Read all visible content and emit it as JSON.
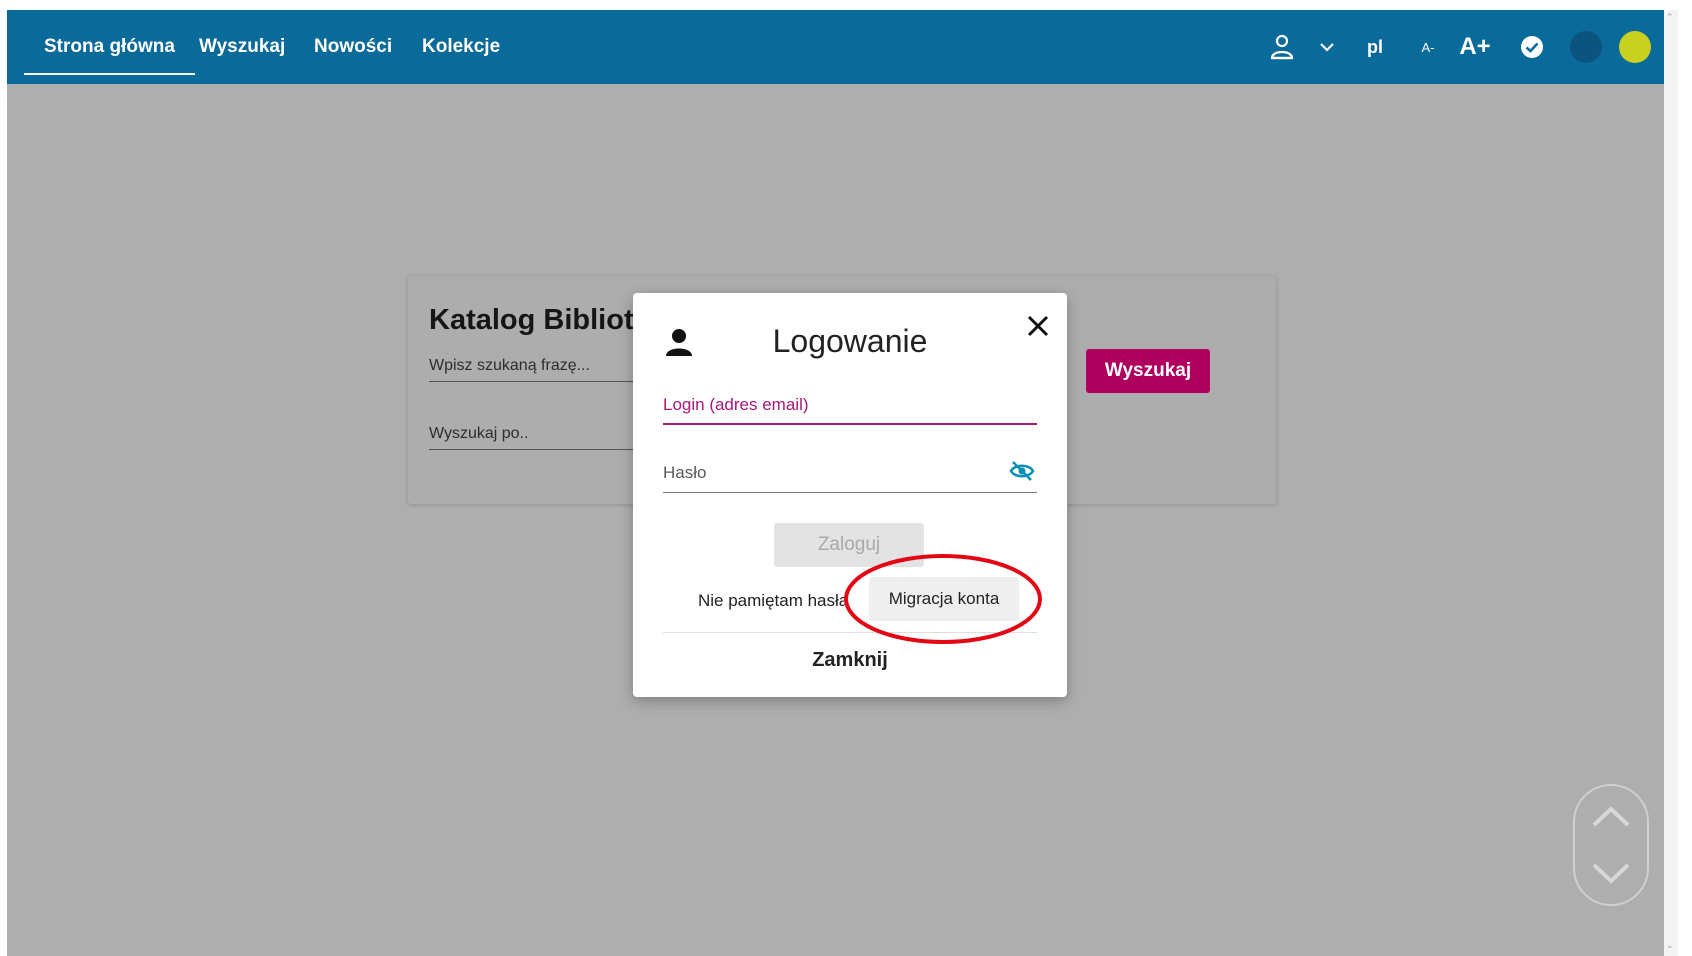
{
  "nav": {
    "items": [
      {
        "label": "Strona główna",
        "active": true
      },
      {
        "label": "Wyszukaj",
        "active": false
      },
      {
        "label": "Nowości",
        "active": false
      },
      {
        "label": "Kolekcje",
        "active": false
      }
    ],
    "language": "pl",
    "font_smaller": "A-",
    "font_larger": "A+",
    "icons": [
      "user-icon",
      "chevron-down-icon",
      "check-circle-icon",
      "theme-dark-icon",
      "theme-contrast-icon"
    ]
  },
  "colors": {
    "topbar": "#0a6a99",
    "accent": "#b0005e",
    "theme_dark": "#0c5480",
    "theme_yellow": "#c8d020",
    "annotation": "#e30613"
  },
  "search_card": {
    "title": "Katalog Bibliot",
    "query_placeholder": "Wpisz szukaną frazę...",
    "search_by_placeholder": "Wyszukaj po..",
    "search_button": "Wyszukaj"
  },
  "login_dialog": {
    "title": "Logowanie",
    "login_label": "Login (adres email)",
    "password_label": "Hasło",
    "submit_label": "Zaloguj",
    "forgot_label": "Nie pamiętam hasła",
    "migrate_label": "Migracja konta",
    "close_label": "Zamknij"
  }
}
